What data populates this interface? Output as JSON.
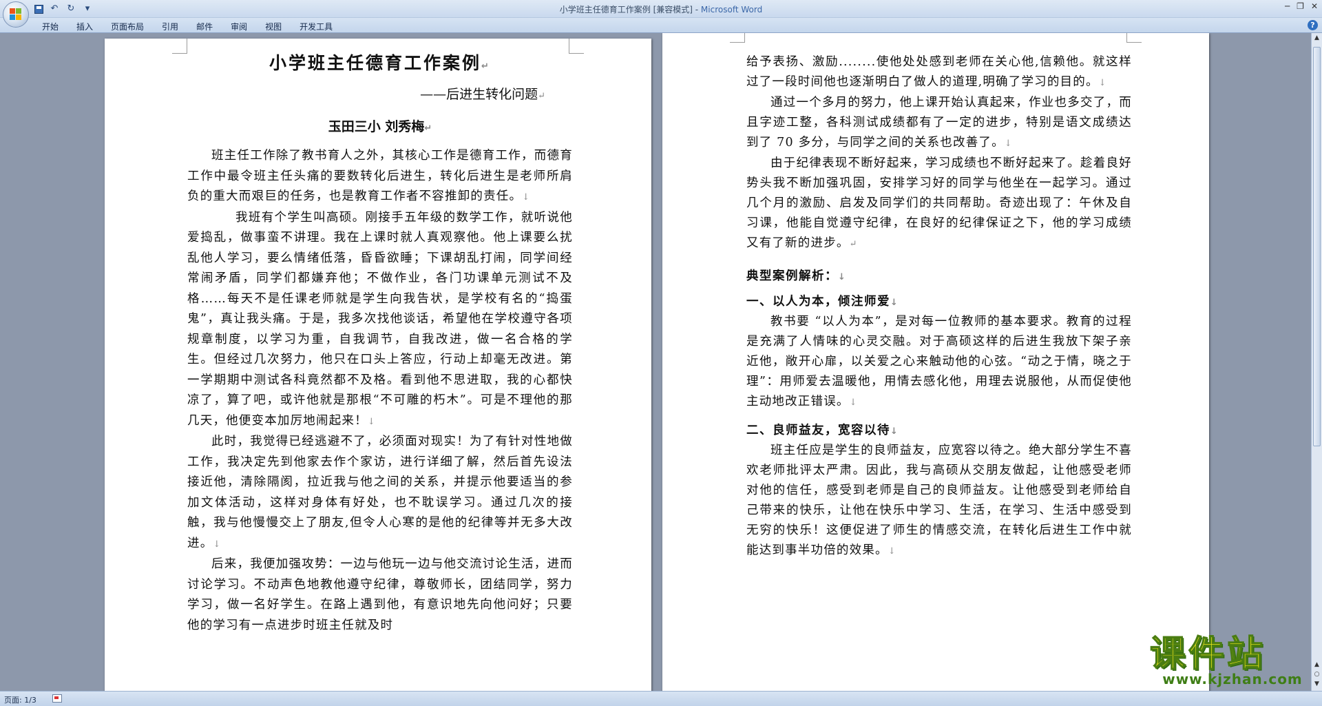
{
  "window": {
    "title_doc": "小学班主任德育工作案例 [兼容模式] - ",
    "title_app": "Microsoft Word"
  },
  "ribbon": {
    "tabs": [
      "开始",
      "插入",
      "页面布局",
      "引用",
      "邮件",
      "审阅",
      "视图",
      "开发工具"
    ]
  },
  "left_page": {
    "title": "小学班主任德育工作案例",
    "subtitle": "——后进生转化问题",
    "author": "玉田三小    刘秀梅",
    "paragraphs": [
      "班主任工作除了教书育人之外，其核心工作是德育工作，而德育工作中最令班主任头痛的要数转化后进生，转化后进生是老师所肩负的重大而艰巨的任务，也是教育工作者不容推卸的责任。",
      "我班有个学生叫高硕。刚接手五年级的数学工作，就听说他爱捣乱，做事蛮不讲理。我在上课时就人真观察他。他上课要么扰乱他人学习，要么情绪低落，昏昏欲睡；下课胡乱打闹，同学间经常闹矛盾，同学们都嫌弃他；不做作业，各门功课单元测试不及格……每天不是任课老师就是学生向我告状，是学校有名的“捣蛋鬼”，真让我头痛。于是，我多次找他谈话，希望他在学校遵守各项规章制度，以学习为重，自我调节，自我改进，做一名合格的学生。但经过几次努力，他只在口头上答应，行动上却毫无改进。第一学期期中测试各科竟然都不及格。看到他不思进取，我的心都快凉了，算了吧，或许他就是那根“不可雕的朽木”。可是不理他的那几天，他便变本加厉地闹起来！",
      "此时，我觉得已经逃避不了，必须面对现实！为了有针对性地做工作，我决定先到他家去作个家访，进行详细了解，然后首先设法接近他，清除隔阂，拉近我与他之间的关系，并提示他要适当的参加文体活动，这样对身体有好处，也不耽误学习。通过几次的接触，我与他慢慢交上了朋友,但令人心寒的是他的纪律等并无多大改进。",
      "后来，我便加强攻势：一边与他玩一边与他交流讨论生活，进而讨论学习。不动声色地教他遵守纪律，尊敬师长，团结同学，努力学习，做一名好学生。在路上遇到他，有意识地先向他问好；只要他的学习有一点进步时班主任就及时"
    ]
  },
  "right_page": {
    "paragraphs_top": [
      "给予表扬、激励........使他处处感到老师在关心他,信赖他。就这样过了一段时间他也逐渐明白了做人的道理,明确了学习的目的。",
      "通过一个多月的努力，他上课开始认真起来，作业也多交了，而且字迹工整，各科测试成绩都有了一定的进步，特别是语文成绩达到了 70 多分，与同学之间的关系也改善了。",
      "由于纪律表现不断好起来，学习成绩也不断好起来了。趁着良好势头我不断加强巩固，安排学习好的同学与他坐在一起学习。通过几个月的激励、启发及同学们的共同帮助。奇迹出现了：午休及自习课，他能自觉遵守纪律，在良好的纪律保证之下，他的学习成绩又有了新的进步。"
    ],
    "heading_main": "典型案例解析：",
    "section1_heading": "一、以人为本，倾注师爱",
    "section1_text": "教书要 “以人为本”，是对每一位教师的基本要求。教育的过程是充满了人情味的心灵交融。对于高硕这样的后进生我放下架子亲近他，敞开心扉，以关爱之心来触动他的心弦。“动之于情，晓之于理”：用师爱去温暖他，用情去感化他，用理去说服他，从而促使他主动地改正错误。",
    "section2_heading": "二、良师益友，宽容以待",
    "section2_text": "班主任应是学生的良师益友，应宽容以待之。绝大部分学生不喜欢老师批评太严肃。因此，我与高硕从交朋友做起，让他感受老师对他的信任，感受到老师是自己的良师益友。让他感受到老师给自己带来的快乐，让他在快乐中学习、生活，在学习、生活中感受到无穷的快乐！这便促进了师生的情感交流，在转化后进生工作中就能达到事半功倍的效果。"
  },
  "statusbar": {
    "page_info": "页面: 1/3"
  },
  "watermark": {
    "main": "课件站",
    "url": "www.kjzhan.com"
  }
}
